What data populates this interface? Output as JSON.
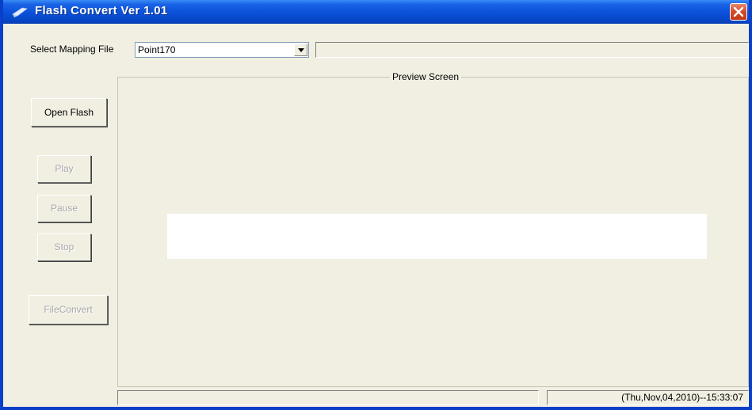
{
  "window": {
    "title": "Flash Convert Ver 1.01"
  },
  "mapping": {
    "label": "Select Mapping File",
    "selected": "Point170",
    "status": ""
  },
  "buttons": {
    "open_flash": "Open Flash",
    "play": "Play",
    "pause": "Pause",
    "stop": "Stop",
    "file_convert": "FileConvert"
  },
  "preview": {
    "legend": "Preview Screen"
  },
  "statusbar": {
    "left": "",
    "datetime": "(Thu,Nov,04,2010)--15:33:07"
  },
  "colors": {
    "titlebar": "#0a50d8",
    "window_bg": "#f1efe2",
    "close_button": "#d24a26"
  }
}
